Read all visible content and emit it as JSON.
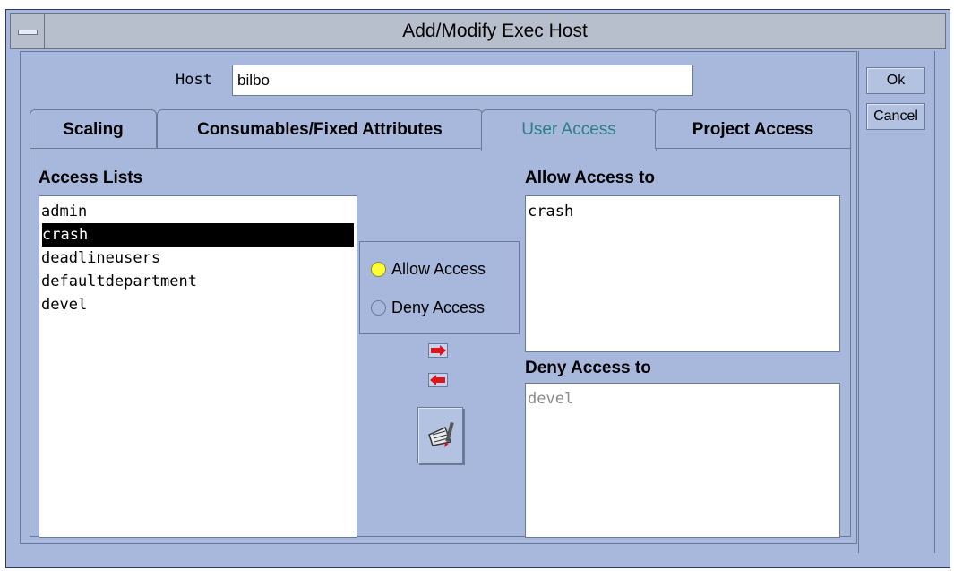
{
  "window": {
    "title": "Add/Modify Exec Host"
  },
  "host": {
    "label": "Host",
    "value": "bilbo"
  },
  "tabs": [
    {
      "label": "Scaling"
    },
    {
      "label": "Consumables/Fixed Attributes"
    },
    {
      "label": "User Access",
      "active": true
    },
    {
      "label": "Project Access"
    }
  ],
  "access_lists": {
    "label": "Access Lists",
    "items": [
      "admin",
      "crash",
      "deadlineusers",
      "defaultdepartment",
      "devel"
    ],
    "selected": "crash"
  },
  "access_mode": {
    "allow_label": "Allow Access",
    "deny_label": "Deny Access",
    "selected": "Allow Access"
  },
  "allow_list": {
    "label": "Allow Access to",
    "items": [
      "crash"
    ]
  },
  "deny_list": {
    "label": "Deny Access to",
    "items": [
      "devel"
    ]
  },
  "buttons": {
    "ok": "Ok",
    "cancel": "Cancel"
  },
  "icons": {
    "add": "right-arrow-icon",
    "remove": "left-arrow-icon",
    "edit": "edit-access-list-icon"
  },
  "colors": {
    "window_bg": "#a8b8dc",
    "active_tab": "#2c7f86",
    "radio_on": "#ffff33",
    "arrow_red": "#e0141c"
  }
}
